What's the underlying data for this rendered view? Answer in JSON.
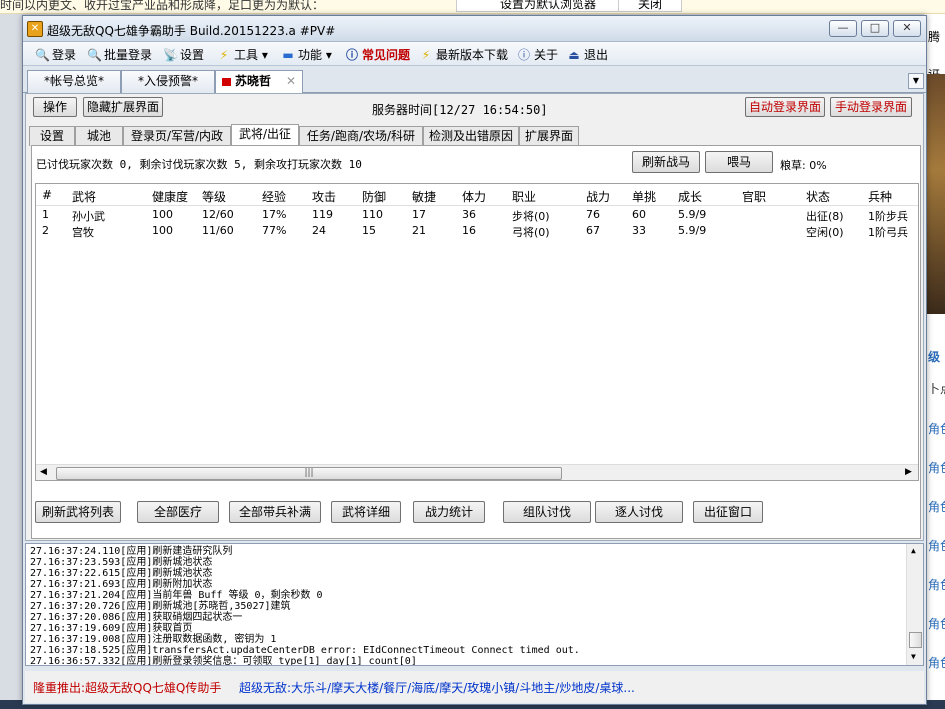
{
  "background": {
    "top_text": "时间以内更文、收开过宝产业品和形成降，足口更为为默认：",
    "top_button1": "设置为默认浏览器",
    "top_button2": "关闭",
    "right_texts": [
      "腾",
      "讶",
      "级",
      "卜点",
      "角色",
      "角色",
      "角色",
      "角色",
      "角色",
      "角色",
      "角色"
    ]
  },
  "window": {
    "title": "超级无敌QQ七雄争霸助手 Build.20151223.a #PV#",
    "controls": [
      "—",
      "□",
      "✕"
    ]
  },
  "menu": [
    {
      "icon": "magnifier-icon",
      "glyph": "🔍",
      "label": "登录",
      "color": "#000"
    },
    {
      "icon": "magnifier-icon",
      "glyph": "🔍",
      "label": "批量登录",
      "color": "#000"
    },
    {
      "icon": "antenna-icon",
      "glyph": "📡",
      "label": "设置",
      "color": "#000"
    },
    {
      "icon": "bolt-icon",
      "glyph": "⚡",
      "label": "工具 ▾",
      "color": "#000"
    },
    {
      "icon": "pill-icon",
      "glyph": "▬",
      "label": "功能 ▾",
      "color": "#000"
    },
    {
      "icon": "info-icon",
      "glyph": "ⓘ",
      "label": "常见问题",
      "color": "#c00000"
    },
    {
      "icon": "bolt-icon",
      "glyph": "⚡",
      "label": "最新版本下载",
      "color": "#000"
    },
    {
      "icon": "info-icon",
      "glyph": "ⓘ",
      "label": "关于",
      "color": "#000"
    },
    {
      "icon": "exit-icon",
      "glyph": "⏏",
      "label": "退出",
      "color": "#000"
    }
  ],
  "account_tabs": [
    "*帐号总览*",
    "*入侵预警*",
    "苏晓哲"
  ],
  "toolbar": {
    "operate": "操作",
    "hide_ext": "隐藏扩展界面",
    "server_time": "服务器时间[12/27 16:54:50]",
    "auto_login": "自动登录界面",
    "manual_login": "手动登录界面"
  },
  "sub_tabs": [
    "设置",
    "城池",
    "登录页/军营/内政",
    "武将/出征",
    "任务/跑商/农场/科研",
    "检测及出错原因",
    "扩展界面"
  ],
  "panel": {
    "summary": "已讨伐玩家次数 0, 剩余讨伐玩家次数 5, 剩余攻打玩家次数 10",
    "refresh_horse": "刷新战马",
    "feed_horse": "喂马",
    "grain": "粮草: 0%"
  },
  "table": {
    "headers": [
      "#",
      "武将",
      "健康度",
      "等级",
      "经验",
      "攻击",
      "防御",
      "敏捷",
      "体力",
      "职业",
      "战力",
      "单挑",
      "成长",
      "官职",
      "状态",
      "兵种"
    ],
    "rows": [
      [
        "1",
        "孙小武",
        "100",
        "12/60",
        "17%",
        "119",
        "110",
        "17",
        "36",
        "步将(0)",
        "76",
        "60",
        "5.9/9",
        "",
        "出征(8)",
        "1阶步兵"
      ],
      [
        "2",
        "宫牧",
        "100",
        "11/60",
        "77%",
        "24",
        "15",
        "21",
        "16",
        "弓将(0)",
        "67",
        "33",
        "5.9/9",
        "",
        "空闲(0)",
        "1阶弓兵"
      ]
    ]
  },
  "actions": [
    "刷新武将列表",
    "全部医疗",
    "全部带兵补满",
    "武将详细",
    "战力统计",
    "组队讨伐",
    "逐人讨伐",
    "出征窗口"
  ],
  "log": [
    "27.16:37:24.110[应用]刷新建造研究队列",
    "27.16:37:23.593[应用]刷新城池状态",
    "27.16:37:22.615[应用]刷新城池状态",
    "27.16:37:21.693[应用]刷新附加状态",
    "27.16:37:21.204[应用]当前年兽 Buff 等级 0，剩余秒数 0",
    "27.16:37:20.726[应用]刷新城池[苏晓哲,35027]建筑",
    "27.16:37:20.086[应用]获取硝烟四起状态一",
    "27.16:37:19.609[应用]获取首页",
    "27.16:37:19.008[应用]注册取数据函数, 密钥为 1",
    "27.16:37:18.525[应用]transfersAct.updateCenterDB error: EIdConnectTimeout Connect timed out.",
    "27.16:36:57.332[应用]刷新登录领奖信息：可领取 type[1] day[1] count[0]"
  ],
  "status": {
    "promo1": "隆重推出:超级无敌QQ七雄Q传助手",
    "promo2": "超级无敌:大乐斗/摩天大楼/餐厅/海底/摩天/玫瑰小镇/斗地主/炒地皮/桌球..."
  }
}
